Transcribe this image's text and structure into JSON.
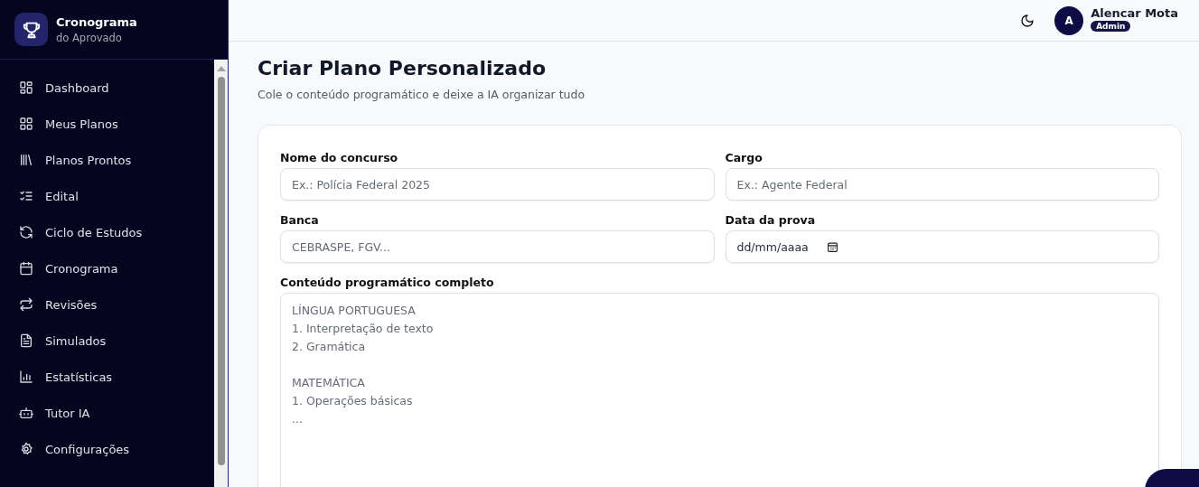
{
  "brand": {
    "title": "Cronograma",
    "subtitle": "do Aprovado"
  },
  "nav": [
    {
      "label": "Dashboard"
    },
    {
      "label": "Meus Planos"
    },
    {
      "label": "Planos Prontos"
    },
    {
      "label": "Edital"
    },
    {
      "label": "Ciclo de Estudos"
    },
    {
      "label": "Cronograma"
    },
    {
      "label": "Revisões"
    },
    {
      "label": "Simulados"
    },
    {
      "label": "Estatísticas"
    },
    {
      "label": "Tutor IA"
    },
    {
      "label": "Configurações"
    }
  ],
  "user": {
    "initial": "A",
    "name": "Alencar Mota",
    "role": "Admin"
  },
  "page": {
    "title": "Criar Plano Personalizado",
    "subtitle": "Cole o conteúdo programático e deixe a IA organizar tudo"
  },
  "fields": [
    {
      "label": "Nome do concurso",
      "kind": "text",
      "placeholder": "Ex.: Polícia Federal 2025"
    },
    {
      "label": "Cargo",
      "kind": "text",
      "placeholder": "Ex.: Agente Federal"
    },
    {
      "label": "Banca",
      "kind": "text",
      "placeholder": "CEBRASPE, FGV..."
    },
    {
      "label": "Data da prova",
      "kind": "date",
      "value": "dd/mm/aaaa"
    }
  ],
  "content": {
    "label": "Conteúdo programático completo",
    "placeholder": "LÍNGUA PORTUGUESA\n1. Interpretação de texto\n2. Gramática\n\nMATEMÁTICA\n1. Operações básicas\n..."
  }
}
